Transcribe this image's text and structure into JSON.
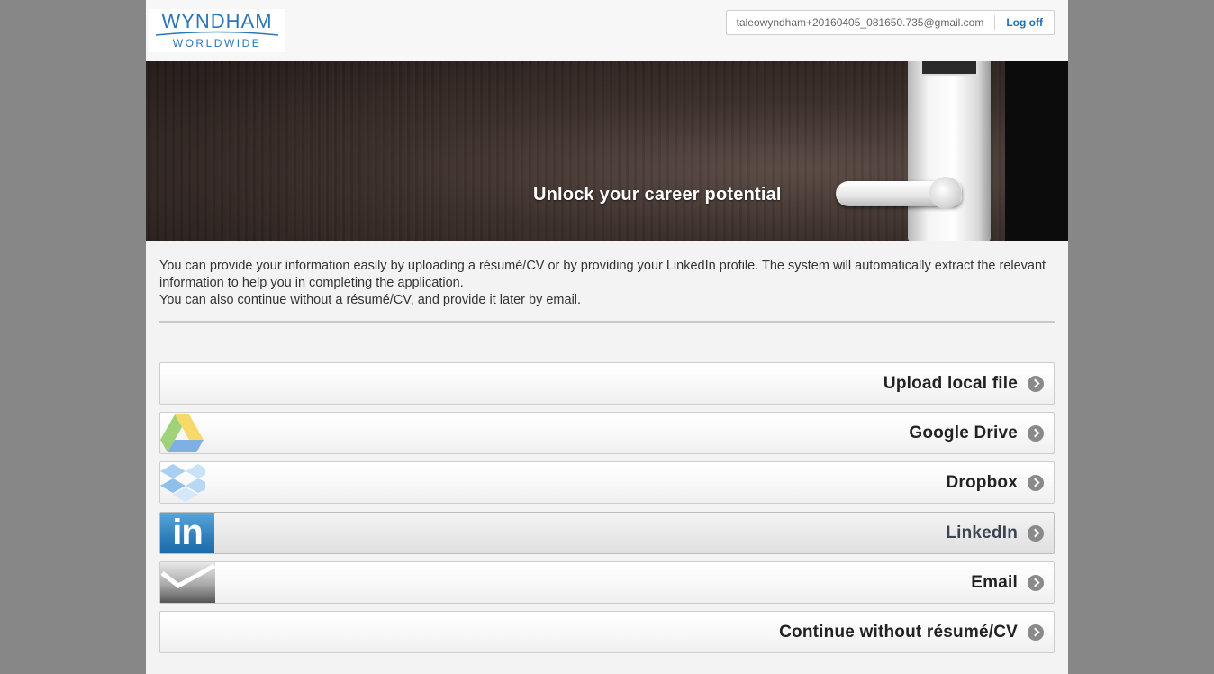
{
  "header": {
    "logo": {
      "line1": "WYNDHAM",
      "line2": "WORLDWIDE"
    },
    "user_email": "taleowyndham+20160405_081650.735@gmail.com",
    "logoff_label": "Log off"
  },
  "banner": {
    "headline": "Unlock your career potential"
  },
  "intro": {
    "line1": "You can provide your information easily by uploading a résumé/CV or by providing your LinkedIn profile. The system will automatically extract the relevant information to help you in completing the application.",
    "line2": "You can also continue without a résumé/CV, and provide it later by email."
  },
  "options": [
    {
      "label": "Upload local file",
      "icon": "none"
    },
    {
      "label": "Google Drive",
      "icon": "google-drive-icon"
    },
    {
      "label": "Dropbox",
      "icon": "dropbox-icon"
    },
    {
      "label": "LinkedIn",
      "icon": "linkedin-icon"
    },
    {
      "label": "Email",
      "icon": "email-icon"
    },
    {
      "label": "Continue without résumé/CV",
      "icon": "none"
    }
  ],
  "colors": {
    "page_bg": "#878787",
    "content_bg": "#f3f3f3",
    "link_blue": "#1f6fb3",
    "brand_blue": "#2b76b9"
  }
}
